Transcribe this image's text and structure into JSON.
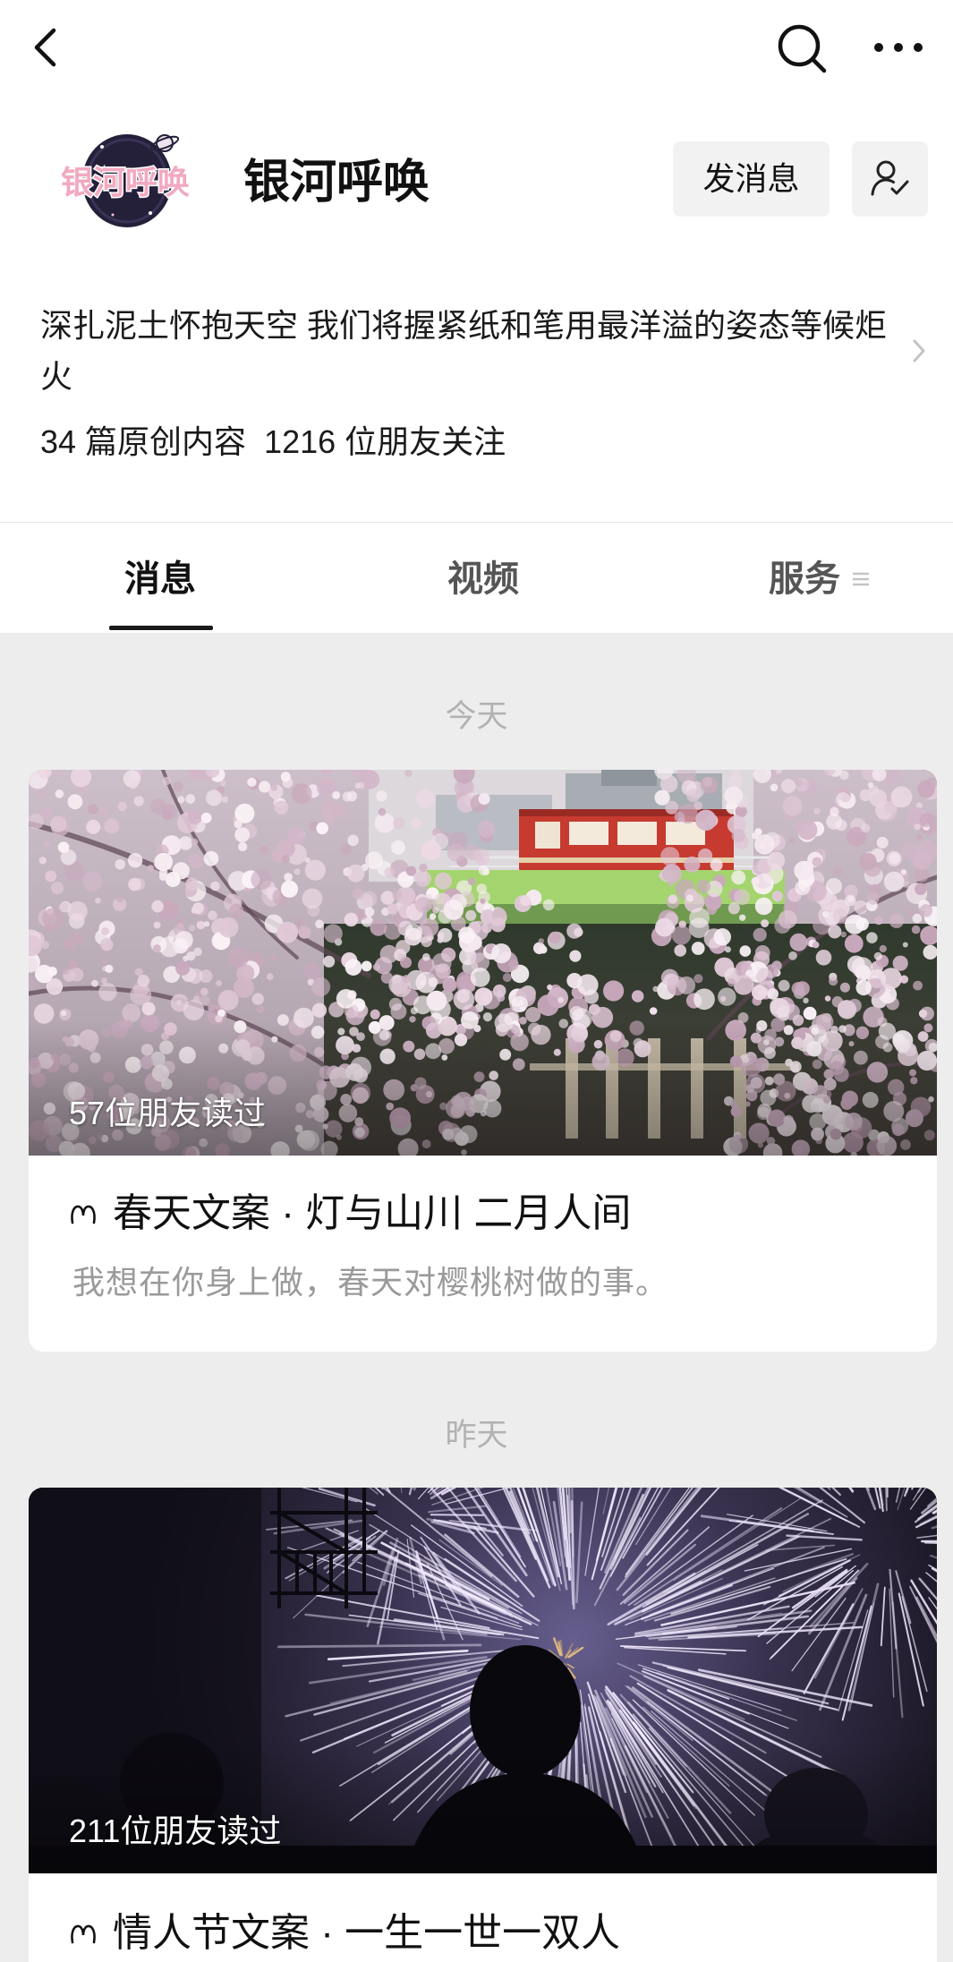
{
  "nav": {
    "back_icon": "chevron-left-icon",
    "search_icon": "search-icon",
    "more_icon": "more-icon"
  },
  "account": {
    "logo_text": "银河呼唤",
    "name": "银河呼唤",
    "message_button": "发消息",
    "follow_icon": "person-check-icon",
    "description": "深扎泥土怀抱天空 我们将握紧纸和笔用最洋溢的姿态等候炬火",
    "description_icon": "chevron-right-icon",
    "stats": {
      "original_posts": "34 篇原创内容",
      "followers": "1216 位朋友关注"
    }
  },
  "tabs": [
    {
      "label": "消息",
      "active": true
    },
    {
      "label": "视频",
      "active": false
    },
    {
      "label": "服务",
      "active": false,
      "icon": "menu-icon"
    }
  ],
  "feed": [
    {
      "date": "今天",
      "articles": [
        {
          "read_count": "57位朋友读过",
          "title_icon": "article-type-icon",
          "title": "春天文案 · 灯与山川 二月人间",
          "summary": "我想在你身上做，春天对樱桃树做的事。"
        }
      ]
    },
    {
      "date": "昨天",
      "articles": [
        {
          "read_count": "211位朋友读过",
          "title_icon": "article-type-icon",
          "title": "情人节文案 · 一生一世一双人"
        }
      ]
    }
  ],
  "colors": {
    "feed_background": "#ededed",
    "date_text": "#b2b2b2",
    "summary_text": "#9a9a9a",
    "button_background": "#f2f2f2",
    "text_primary": "#111111"
  }
}
